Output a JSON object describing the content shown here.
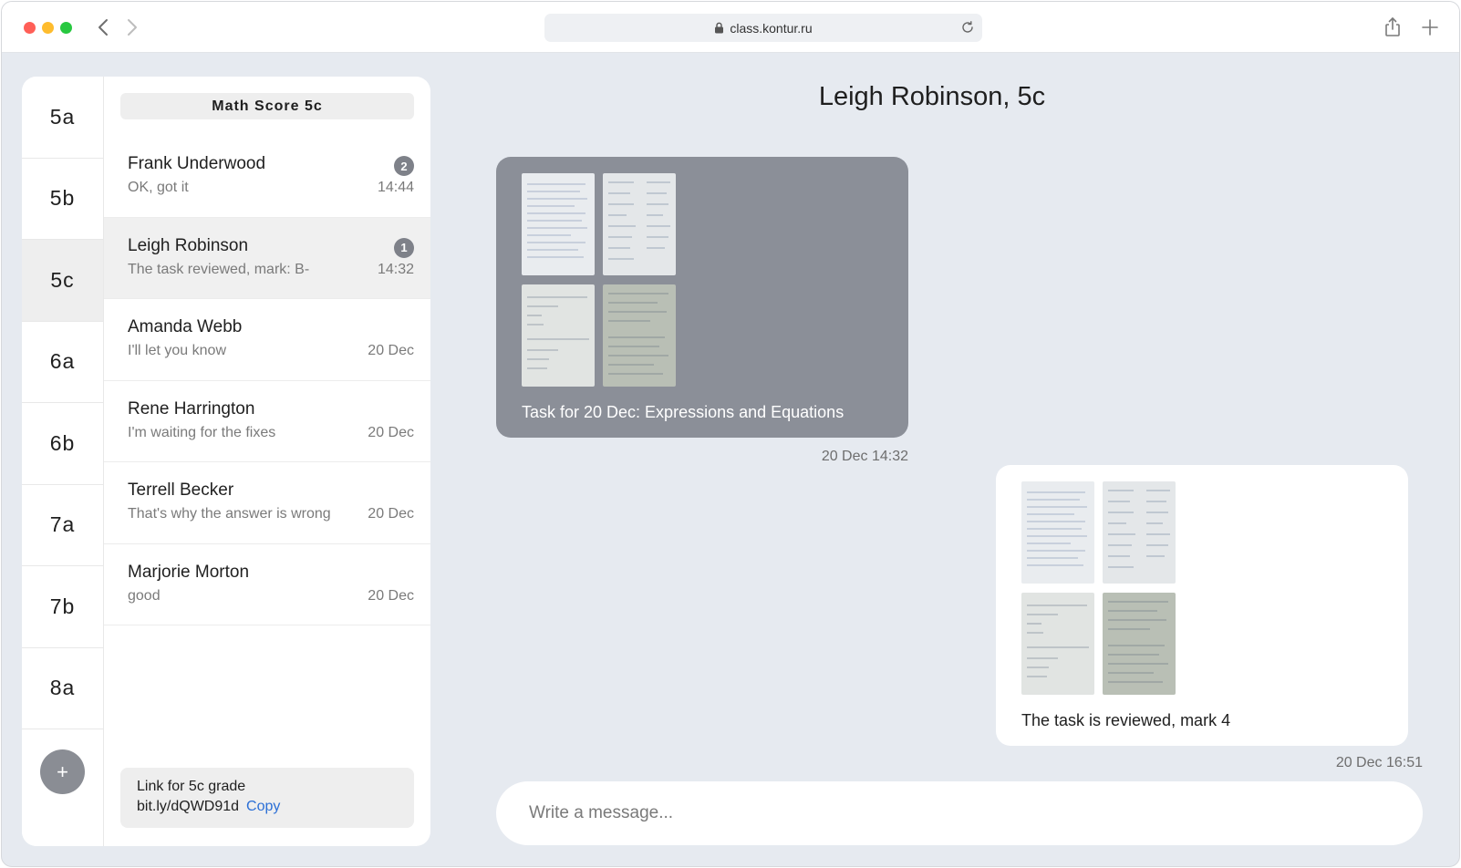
{
  "browser": {
    "url": "class.kontur.ru"
  },
  "sidebar": {
    "classes": [
      "5a",
      "5b",
      "5c",
      "6a",
      "6b",
      "7a",
      "7b",
      "8a"
    ],
    "active_class": "5c",
    "add_label": "+"
  },
  "chats": {
    "title": "Math Score 5c",
    "items": [
      {
        "name": "Frank Underwood",
        "preview": "OK, got it",
        "time": "14:44",
        "badge": "2"
      },
      {
        "name": "Leigh Robinson",
        "preview": "The task reviewed, mark: B-",
        "time": "14:32",
        "badge": "1"
      },
      {
        "name": "Amanda Webb",
        "preview": "I'll let you know",
        "time": "20 Dec",
        "badge": ""
      },
      {
        "name": "Rene Harrington",
        "preview": "I'm waiting for the fixes",
        "time": "20 Dec",
        "badge": ""
      },
      {
        "name": "Terrell Becker",
        "preview": "That's why the answer is wrong",
        "time": "20 Dec",
        "badge": ""
      },
      {
        "name": "Marjorie Morton",
        "preview": "good",
        "time": "20 Dec",
        "badge": ""
      }
    ],
    "link": {
      "label": "Link for 5c grade",
      "url": "bit.ly/dQWD91d",
      "copy_label": "Copy"
    }
  },
  "conversation": {
    "title": "Leigh Robinson, 5c",
    "messages": [
      {
        "direction": "incoming",
        "text": "Task for 20 Dec: Expressions and Equations",
        "time": "20 Dec 14:32"
      },
      {
        "direction": "outgoing",
        "text": "The task is reviewed, mark 4",
        "time": "20 Dec 16:51"
      }
    ],
    "composer_placeholder": "Write a message..."
  },
  "colors": {
    "incoming_bubble": "#8b8f98",
    "outgoing_bubble": "#ffffff",
    "badge": "#7e8189",
    "link_accent": "#2b6fd6",
    "background": "#e6eaf0"
  }
}
